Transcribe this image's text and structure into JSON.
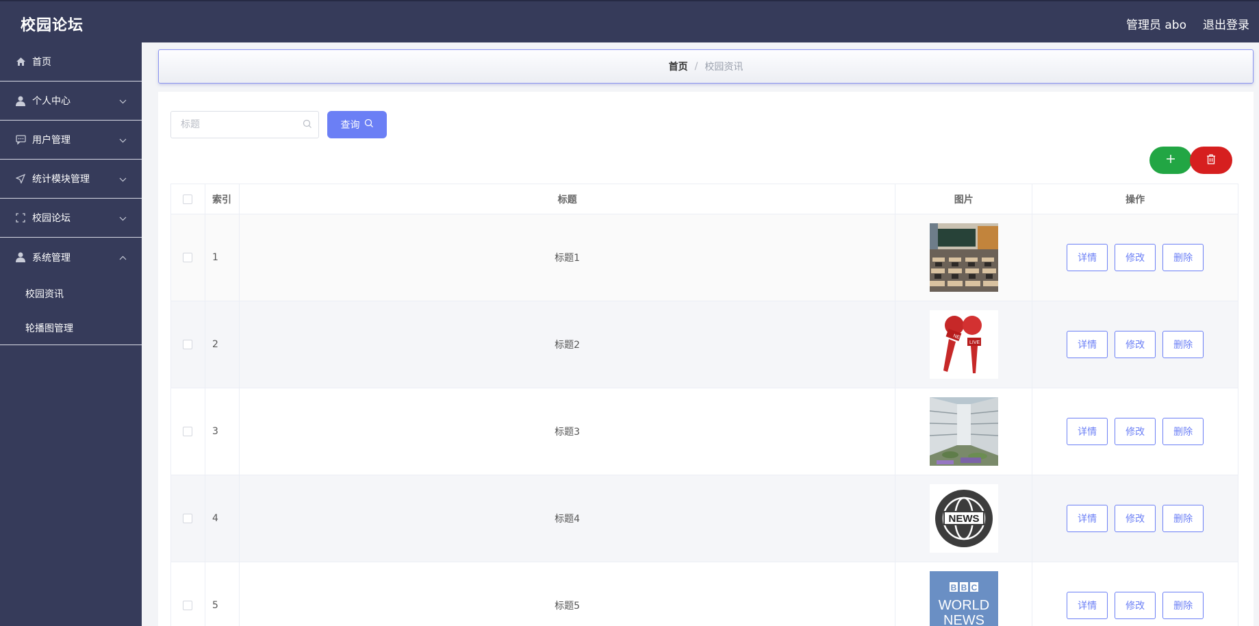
{
  "header": {
    "title": "校园论坛",
    "user_label": "管理员 abo",
    "logout_label": "退出登录"
  },
  "sidebar": {
    "items": [
      {
        "label": "首页",
        "icon": "home-icon"
      },
      {
        "label": "个人中心",
        "icon": "user-icon"
      },
      {
        "label": "用户管理",
        "icon": "chat-icon"
      },
      {
        "label": "统计模块管理",
        "icon": "send-icon"
      },
      {
        "label": "校园论坛",
        "icon": "fullscreen-icon"
      },
      {
        "label": "系统管理",
        "icon": "user-icon"
      }
    ],
    "sub_items": [
      {
        "label": "校园资讯"
      },
      {
        "label": "轮播图管理"
      }
    ]
  },
  "breadcrumb": {
    "home": "首页",
    "separator": "/",
    "current": "校园资讯"
  },
  "search": {
    "placeholder": "标题",
    "button_label": "查询"
  },
  "table": {
    "columns": {
      "index": "索引",
      "title": "标题",
      "image": "图片",
      "actions": "操作"
    },
    "rows": [
      {
        "index": "1",
        "title": "标题1",
        "image": "classroom photo"
      },
      {
        "index": "2",
        "title": "标题2",
        "image": "news live microphones"
      },
      {
        "index": "3",
        "title": "标题3",
        "image": "campus building photo"
      },
      {
        "index": "4",
        "title": "标题4",
        "image": "news globe logo",
        "image_text": "NEWS"
      },
      {
        "index": "5",
        "title": "标题5",
        "image": "bbc world news logo",
        "image_text": [
          "BBC",
          "WORLD",
          "NEWS"
        ]
      }
    ],
    "actions": {
      "detail": "详情",
      "edit": "修改",
      "delete": "删除"
    }
  },
  "colors": {
    "sidebar_bg": "#363b5a",
    "accent": "#6b7ff5",
    "add_button": "#22a644",
    "delete_button": "#d61f1f"
  }
}
